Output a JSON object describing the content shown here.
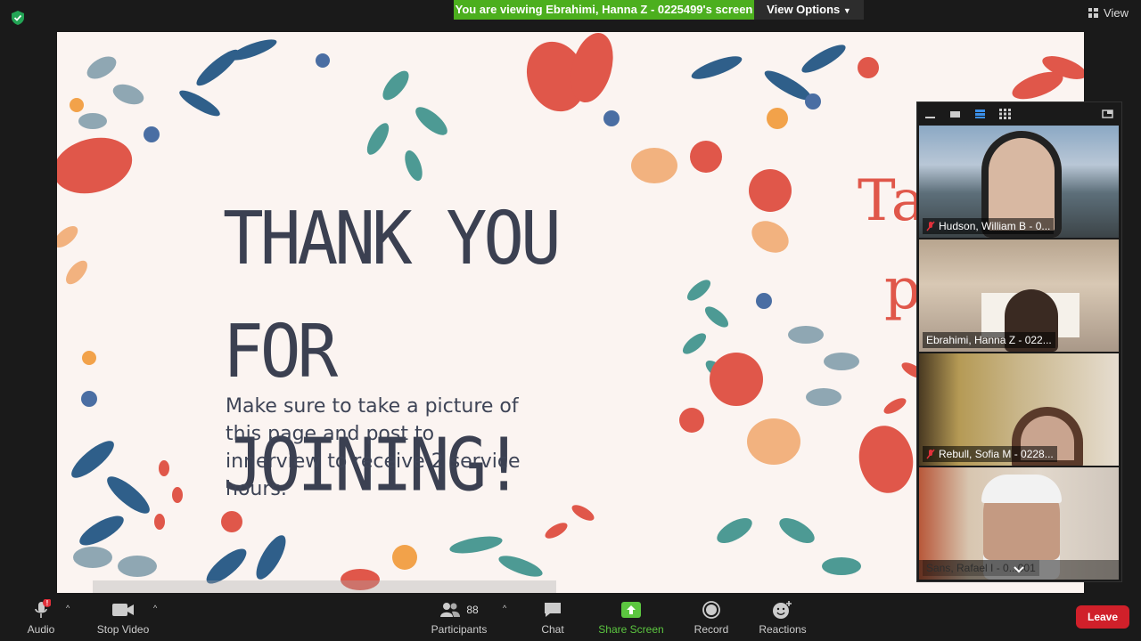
{
  "topbar": {
    "banner": "You are viewing Ebrahimi, Hanna Z - 0225499's screen",
    "view_options": "View Options",
    "view_button": "View"
  },
  "slide": {
    "title_line1": "THANK YOU FOR",
    "title_line2": "JOINING!",
    "body": "Make sure to take a picture of this page and post to innerview to receive 2 service hours.",
    "partial_right_line1": "Tak",
    "partial_right_line2": "pi"
  },
  "gallery": {
    "tiles": [
      {
        "name": "Hudson, William B - 0...",
        "muted": true
      },
      {
        "name": "Ebrahimi, Hanna Z - 022...",
        "muted": false
      },
      {
        "name": "Rebull, Sofia M - 0228...",
        "muted": true
      },
      {
        "name": "Sans, Rafael I - 0...001",
        "muted": false
      }
    ]
  },
  "toolbar": {
    "audio": "Audio",
    "stop_video": "Stop Video",
    "participants": "Participants",
    "participants_count": "88",
    "chat": "Chat",
    "share_screen": "Share Screen",
    "record": "Record",
    "reactions": "Reactions",
    "leave": "Leave"
  },
  "colors": {
    "banner_green": "#4caf1e",
    "share_green": "#5cc640",
    "leave_red": "#d0202a",
    "active_tile_border": "#6cc04a"
  }
}
